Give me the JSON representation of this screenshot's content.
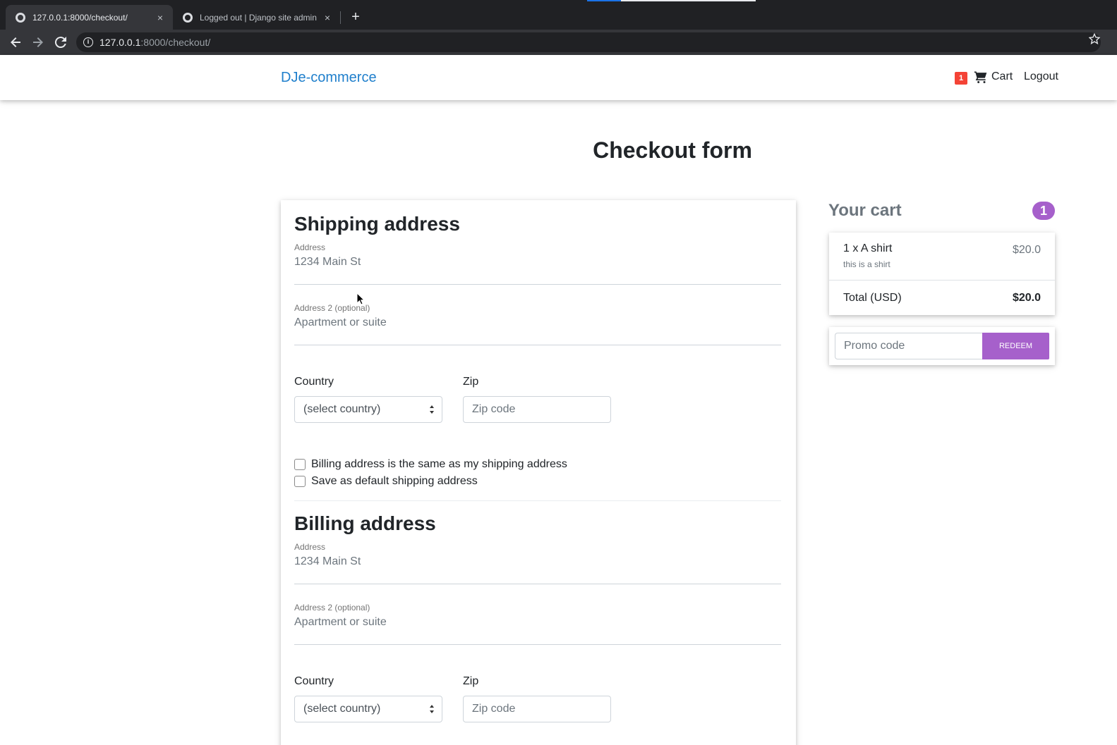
{
  "browser": {
    "tabs": [
      {
        "title": "127.0.0.1:8000/checkout/",
        "active": true
      },
      {
        "title": "Logged out | Django site admin",
        "active": false
      }
    ],
    "close_glyph": "×",
    "new_tab_glyph": "+",
    "url_host": "127.0.0.1",
    "url_path": ":8000/checkout/",
    "icons": [
      "back-arrow-icon",
      "forward-arrow-icon",
      "reload-icon",
      "info-icon",
      "star-icon"
    ]
  },
  "navbar": {
    "brand": "DJe-commerce",
    "cart_badge": "1",
    "cart_label": "Cart",
    "logout_label": "Logout"
  },
  "page": {
    "title": "Checkout form"
  },
  "shipping": {
    "title": "Shipping address",
    "address_label": "Address",
    "address_placeholder": "1234 Main St",
    "address2_label": "Address 2 (optional)",
    "address2_placeholder": "Apartment or suite",
    "country_label": "Country",
    "country_selected": "(select country)",
    "zip_label": "Zip",
    "zip_placeholder": "Zip code",
    "same_billing_label": "Billing address is the same as my shipping address",
    "save_default_label": "Save as default shipping address"
  },
  "billing": {
    "title": "Billing address",
    "address_label": "Address",
    "address_placeholder": "1234 Main St",
    "address2_label": "Address 2 (optional)",
    "address2_placeholder": "Apartment or suite",
    "country_label": "Country",
    "country_selected": "(select country)",
    "zip_label": "Zip",
    "zip_placeholder": "Zip code"
  },
  "cart": {
    "heading": "Your cart",
    "count": "1",
    "items": [
      {
        "name": "1 x A shirt",
        "description": "this is a shirt",
        "price": "$20.0"
      }
    ],
    "total_label": "Total (USD)",
    "total_value": "$20.0",
    "promo_placeholder": "Promo code",
    "redeem_label": "Redeem"
  },
  "colors": {
    "brand": "#1f7fcc",
    "accent_purple": "#a660cb",
    "badge_red": "#f44336"
  }
}
